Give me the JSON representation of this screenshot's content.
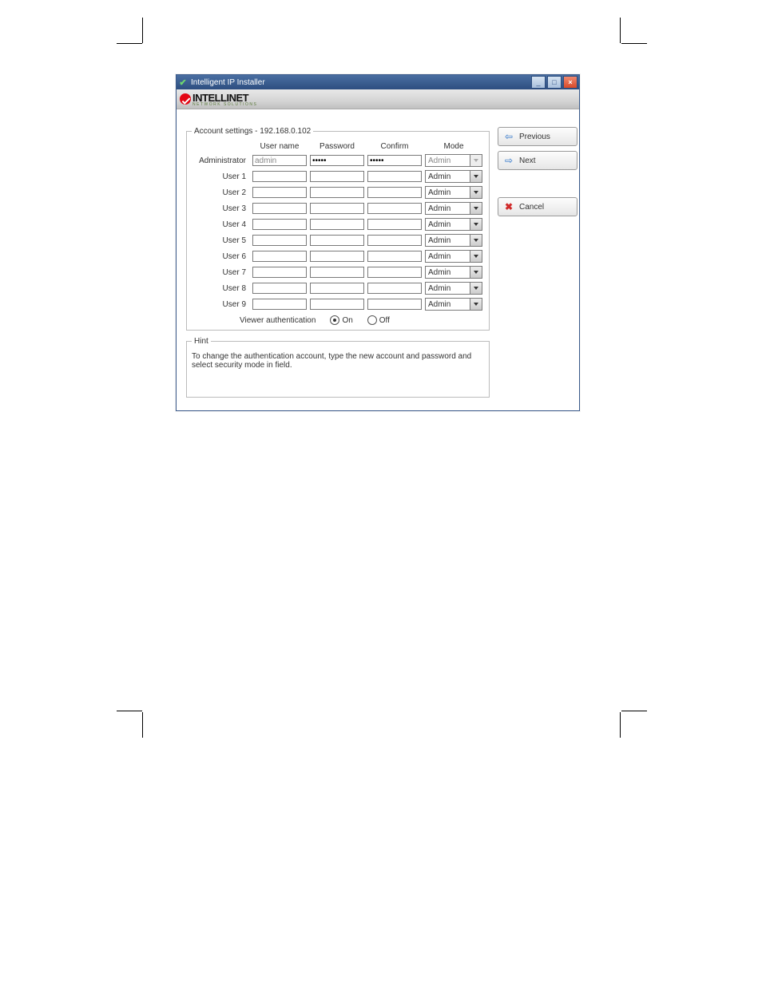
{
  "window": {
    "title": "Intelligent IP Installer",
    "brand": {
      "name": "INTELLINET",
      "tagline": "NETWORK SOLUTIONS"
    }
  },
  "fieldset": {
    "legend": "Account settings - 192.168.0.102"
  },
  "columns": {
    "username": "User name",
    "password": "Password",
    "confirm": "Confirm",
    "mode": "Mode"
  },
  "rows": [
    {
      "label": "Administrator",
      "username": "admin",
      "password": "*****",
      "confirm": "*****",
      "mode": "Admin",
      "locked": true
    },
    {
      "label": "User 1",
      "username": "",
      "password": "",
      "confirm": "",
      "mode": "Admin",
      "locked": false
    },
    {
      "label": "User 2",
      "username": "",
      "password": "",
      "confirm": "",
      "mode": "Admin",
      "locked": false
    },
    {
      "label": "User 3",
      "username": "",
      "password": "",
      "confirm": "",
      "mode": "Admin",
      "locked": false
    },
    {
      "label": "User 4",
      "username": "",
      "password": "",
      "confirm": "",
      "mode": "Admin",
      "locked": false
    },
    {
      "label": "User 5",
      "username": "",
      "password": "",
      "confirm": "",
      "mode": "Admin",
      "locked": false
    },
    {
      "label": "User 6",
      "username": "",
      "password": "",
      "confirm": "",
      "mode": "Admin",
      "locked": false
    },
    {
      "label": "User 7",
      "username": "",
      "password": "",
      "confirm": "",
      "mode": "Admin",
      "locked": false
    },
    {
      "label": "User 8",
      "username": "",
      "password": "",
      "confirm": "",
      "mode": "Admin",
      "locked": false
    },
    {
      "label": "User 9",
      "username": "",
      "password": "",
      "confirm": "",
      "mode": "Admin",
      "locked": false
    }
  ],
  "viewer_auth": {
    "label": "Viewer authentication",
    "on_label": "On",
    "off_label": "Off",
    "value": "on"
  },
  "hint": {
    "legend": "Hint",
    "text": "To change the authentication account, type the new account and password and select security mode in field."
  },
  "buttons": {
    "previous": "Previous",
    "next": "Next",
    "cancel": "Cancel"
  }
}
